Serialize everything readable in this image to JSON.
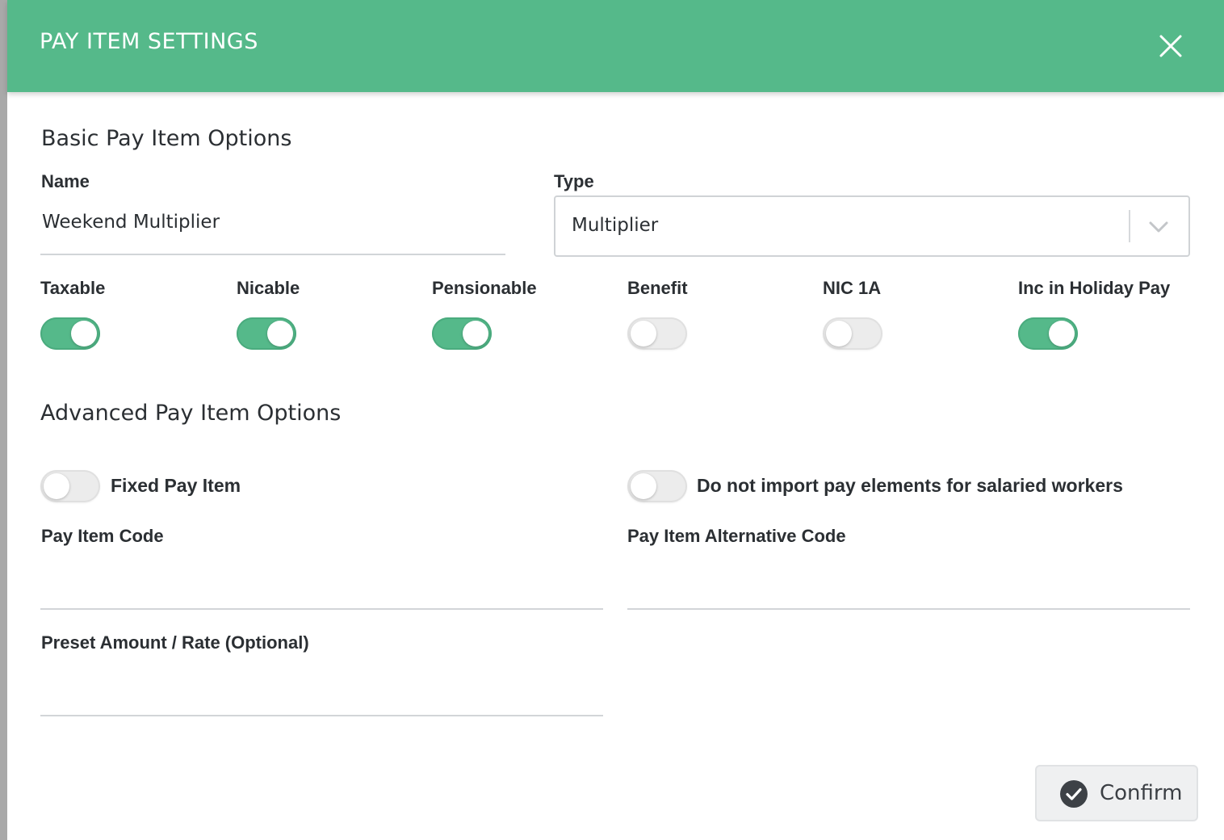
{
  "header": {
    "title": "PAY ITEM SETTINGS",
    "close_icon": "close-icon"
  },
  "basic": {
    "title": "Basic Pay Item Options",
    "name_label": "Name",
    "name_value": "Weekend Multiplier",
    "type_label": "Type",
    "type_value": "Multiplier"
  },
  "toggles": [
    {
      "label": "Taxable",
      "on": true
    },
    {
      "label": "Nicable",
      "on": true
    },
    {
      "label": "Pensionable",
      "on": true
    },
    {
      "label": "Benefit",
      "on": false
    },
    {
      "label": "NIC 1A",
      "on": false
    },
    {
      "label": "Inc in Holiday Pay",
      "on": true
    }
  ],
  "advanced": {
    "title": "Advanced Pay Item Options",
    "fixed_pay_item_label": "Fixed Pay Item",
    "fixed_pay_item_on": false,
    "no_import_label": "Do not import pay elements for salaried workers",
    "no_import_on": false,
    "pay_item_code_label": "Pay Item Code",
    "pay_item_code_value": "",
    "alt_code_label": "Pay Item Alternative Code",
    "alt_code_value": "",
    "preset_label": "Preset Amount / Rate (Optional)",
    "preset_value": ""
  },
  "footer": {
    "confirm_label": "Confirm"
  },
  "colors": {
    "accent": "#55b98a",
    "toggle_off": "#ececec",
    "button_bg": "#eff0f1"
  }
}
